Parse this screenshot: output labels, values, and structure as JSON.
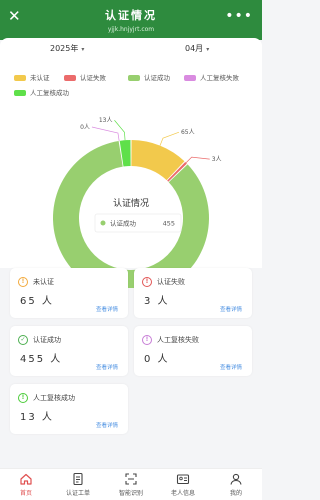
{
  "nav": {
    "title": "认证情况",
    "url": "yjjk.hnjyjrt.com"
  },
  "filters": {
    "year": "2025年",
    "month": "04月"
  },
  "legend": [
    {
      "label": "未认证",
      "color": "#f2c94c"
    },
    {
      "label": "认证失败",
      "color": "#eb6b6b"
    },
    {
      "label": "认证成功",
      "color": "#98cf6f"
    },
    {
      "label": "人工复核失败",
      "color": "#d98be0"
    },
    {
      "label": "人工复核成功",
      "color": "#5fe04a"
    }
  ],
  "chart_data": {
    "type": "pie",
    "title": "认证情况",
    "categories": [
      "未认证",
      "认证失败",
      "认证成功",
      "人工复核失败",
      "人工复核成功"
    ],
    "values": [
      65,
      3,
      455,
      0,
      13
    ],
    "unit": "人",
    "slice_labels": [
      "65人",
      "3人",
      "455人",
      "0人",
      "13人"
    ],
    "colors": [
      "#f2c94c",
      "#eb6b6b",
      "#98cf6f",
      "#d98be0",
      "#5fe04a"
    ],
    "tooltip": {
      "label": "认证成功",
      "value": "455"
    }
  },
  "cards": [
    {
      "label": "未认证",
      "value": "65 人",
      "link": "查看详情",
      "color": "#f2a93b",
      "icon": "exclamation-icon"
    },
    {
      "label": "认证失败",
      "value": "3 人",
      "link": "查看详情",
      "color": "#e25555",
      "icon": "exclamation-icon"
    },
    {
      "label": "认证成功",
      "value": "455 人",
      "link": "查看详情",
      "color": "#4caf50",
      "icon": "check-icon"
    },
    {
      "label": "人工复核失败",
      "value": "0 人",
      "link": "查看详情",
      "color": "#c77dd6",
      "icon": "exclamation-icon"
    },
    {
      "label": "人工复核成功",
      "value": "13 人",
      "link": "查看详情",
      "color": "#4ccc3a",
      "icon": "exclamation-icon"
    }
  ],
  "tabs": [
    {
      "label": "首页",
      "icon": "home-icon",
      "active": true
    },
    {
      "label": "认证工单",
      "icon": "document-icon",
      "active": false
    },
    {
      "label": "智能识别",
      "icon": "scan-icon",
      "active": false
    },
    {
      "label": "老人信息",
      "icon": "id-card-icon",
      "active": false
    },
    {
      "label": "我的",
      "icon": "user-icon",
      "active": false
    }
  ]
}
